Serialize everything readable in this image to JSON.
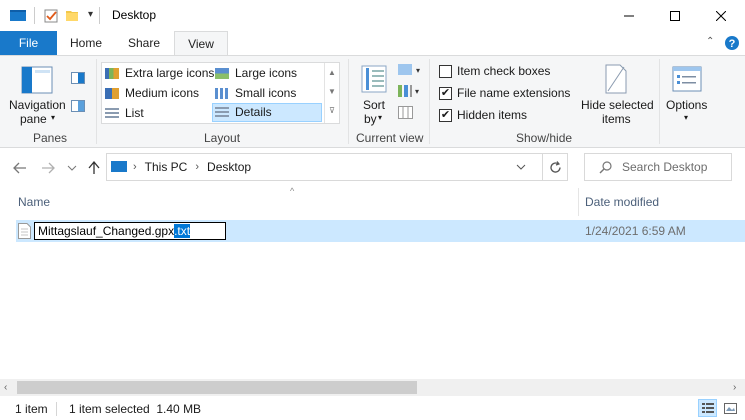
{
  "window": {
    "title": "Desktop"
  },
  "title_buttons": {
    "minimize": "minimize-icon",
    "maximize": "maximize-icon",
    "close": "close-icon"
  },
  "tabs": [
    {
      "label": "File"
    },
    {
      "label": "Home"
    },
    {
      "label": "Share"
    },
    {
      "label": "View"
    }
  ],
  "ribbon": {
    "panes": {
      "navigation_pane_label_1": "Navigation",
      "navigation_pane_label_2": "pane",
      "group_label": "Panes"
    },
    "layout": {
      "items": [
        {
          "label": "Extra large icons"
        },
        {
          "label": "Large icons"
        },
        {
          "label": "Medium icons"
        },
        {
          "label": "Small icons"
        },
        {
          "label": "List"
        },
        {
          "label": "Details"
        }
      ],
      "selected": "Details",
      "group_label": "Layout"
    },
    "current_view": {
      "sort_label_1": "Sort",
      "sort_label_2": "by",
      "group_label": "Current view"
    },
    "show_hide": {
      "item_check_boxes": {
        "label": "Item check boxes",
        "checked": false
      },
      "file_name_extensions": {
        "label": "File name extensions",
        "checked": true
      },
      "hidden_items": {
        "label": "Hidden items",
        "checked": true
      },
      "hide_selected_1": "Hide selected",
      "hide_selected_2": "items",
      "group_label": "Show/hide"
    },
    "options": {
      "label": "Options"
    }
  },
  "address": {
    "breadcrumb": [
      "This PC",
      "Desktop"
    ],
    "search_placeholder": "Search Desktop"
  },
  "columns": {
    "name": "Name",
    "date_modified": "Date modified"
  },
  "files": [
    {
      "name_base": "Mittagslauf_Changed.gpx",
      "name_ext_selected": ".txt",
      "date_modified": "1/24/2021 6:59 AM"
    }
  ],
  "status": {
    "item_count": "1 item",
    "selection": "1 item selected  1.40 MB"
  },
  "colors": {
    "accent": "#1979ca",
    "selection": "#cce8ff",
    "text_selection": "#0078d7"
  }
}
